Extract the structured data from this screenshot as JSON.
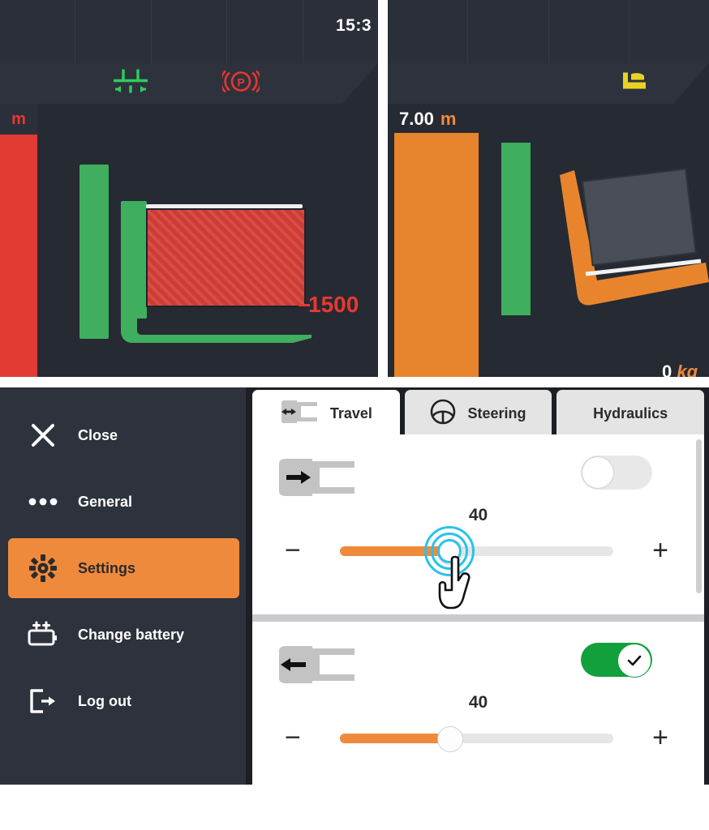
{
  "top_left_panel": {
    "clock": "15:3",
    "icons": [
      {
        "name": "fork-centering-icon",
        "color": "#2ecc5e"
      },
      {
        "name": "parking-brake-icon",
        "label": "P",
        "color": "#e8382f"
      }
    ],
    "unit_label": "m",
    "load_value": "1500",
    "load_value_color": "#e8382f",
    "mast_color": "#3fae5f",
    "load_color": "#cf3b32"
  },
  "top_right_panel": {
    "icons": [
      {
        "name": "fork-load-icon",
        "color": "#e8d225"
      }
    ],
    "height_value": "7.00",
    "height_unit": "m",
    "weight_value": "0",
    "weight_unit": "kg",
    "mast_color": "#e8852c",
    "accent_color": "#3fae5f"
  },
  "settings_panel": {
    "sidebar": {
      "items": [
        {
          "label": "Close",
          "icon": "close-icon",
          "active": false
        },
        {
          "label": "General",
          "icon": "ellipsis-icon",
          "active": false
        },
        {
          "label": "Settings",
          "icon": "gear-icon",
          "active": true
        },
        {
          "label": "Change battery",
          "icon": "battery-icon",
          "active": false
        },
        {
          "label": "Log out",
          "icon": "logout-icon",
          "active": false
        }
      ]
    },
    "tabs": [
      {
        "label": "Travel",
        "icon": "fork-bidirectional-icon",
        "active": true
      },
      {
        "label": "Steering",
        "icon": "steering-wheel-icon",
        "active": false
      },
      {
        "label": "Hydraulics",
        "icon": "",
        "active": false
      }
    ],
    "rows": [
      {
        "icon": "fork-forward-icon",
        "toggle_state": "off",
        "value": "40",
        "minus_label": "−",
        "plus_label": "+",
        "slider_percent": 40,
        "has_cursor": true
      },
      {
        "icon": "fork-reverse-icon",
        "toggle_state": "on",
        "value": "40",
        "minus_label": "−",
        "plus_label": "+",
        "slider_percent": 40,
        "has_cursor": false
      }
    ],
    "colors": {
      "accent_orange": "#ef8a3c",
      "toggle_on_green": "#11a03c",
      "sidebar_dark": "#2e323c",
      "ripple_cyan": "#29c3e8"
    }
  }
}
